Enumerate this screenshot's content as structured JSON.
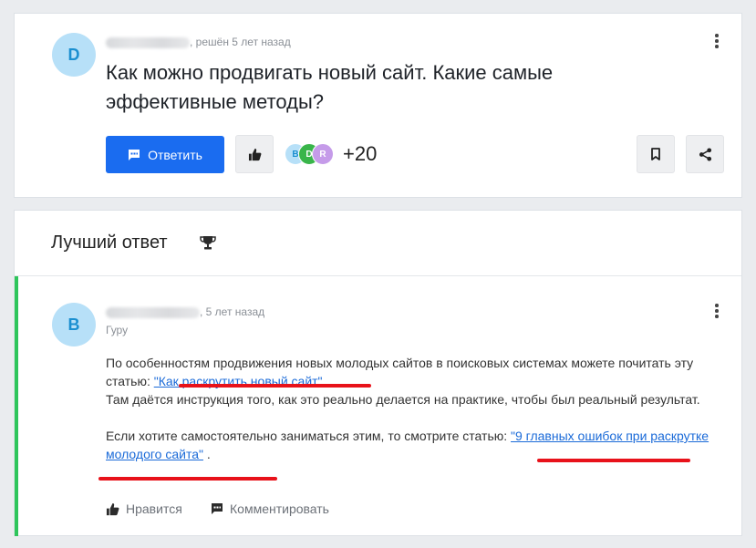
{
  "question": {
    "avatar_letter": "D",
    "author_name_hidden": "",
    "meta": ", решён 5 лет назад",
    "title": "Как можно продвигать новый сайт. Какие самые эффективные методы?",
    "answer_button_label": "Ответить",
    "follower_avatars": [
      "B",
      "D",
      "R"
    ],
    "followers_count": "+20",
    "colors": {
      "primary": "#1a6cf0",
      "avatar_bg": "#b7e0f8",
      "avatar_fg": "#1b8fd0"
    }
  },
  "best_answer": {
    "section_title": "Лучший ответ",
    "avatar_letter": "B",
    "meta": ", 5 лет назад",
    "rank": "Гуру",
    "text_1": "По особенностям продвижения новых молодых сайтов в поисковых системах можете почитать эту статью: ",
    "link_1": "\"Как раскрутить новый сайт\"",
    "text_2": " .",
    "text_3": "Там даётся инструкция того, как это реально делается на практике, чтобы был реальный результат.",
    "text_4": "Если хотите самостоятельно заниматься этим, то смотрите статью: ",
    "link_2": "\"9 главных ошибок при раскрутке молодого сайта\"",
    "text_5": " .",
    "like_label": "Нравится",
    "comment_label": "Комментировать",
    "colors": {
      "accent": "#2ec55b",
      "link": "#1a6ad8",
      "highlight": "#e8121a"
    }
  },
  "icons": [
    "kebab-menu-icon",
    "chat-icon",
    "thumb-up-icon",
    "bookmark-icon",
    "share-icon",
    "trophy-icon",
    "comment-icon"
  ]
}
